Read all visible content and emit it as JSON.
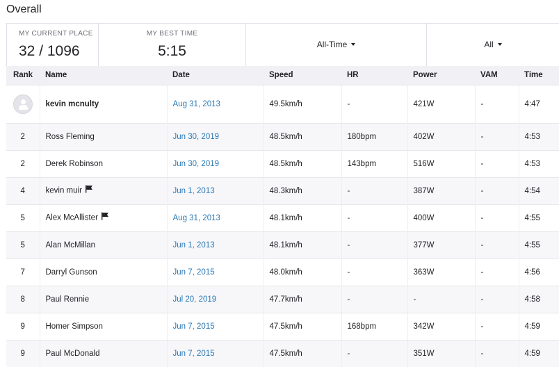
{
  "section": {
    "title": "Overall"
  },
  "stats": {
    "current_place_label": "MY CURRENT PLACE",
    "current_place_value": "32 / 1096",
    "best_time_label": "MY BEST TIME",
    "best_time_value": "5:15",
    "period_select": "All-Time",
    "filter_select": "All"
  },
  "table": {
    "headers": [
      "Rank",
      "Name",
      "Date",
      "Speed",
      "HR",
      "Power",
      "VAM",
      "Time"
    ],
    "rows": [
      {
        "rank": "",
        "name": "kevin mcnulty",
        "date": "Aug 31, 2013",
        "speed": "49.5km/h",
        "hr": "-",
        "power": "421W",
        "vam": "-",
        "time": "4:47",
        "avatar_icon": "user-avatar-icon",
        "flag_icon": ""
      },
      {
        "rank": "2",
        "name": "Ross Fleming",
        "date": "Jun 30, 2019",
        "speed": "48.5km/h",
        "hr": "180bpm",
        "power": "402W",
        "vam": "-",
        "time": "4:53",
        "flag_icon": ""
      },
      {
        "rank": "2",
        "name": "Derek Robinson",
        "date": "Jun 30, 2019",
        "speed": "48.5km/h",
        "hr": "143bpm",
        "power": "516W",
        "vam": "-",
        "time": "4:53",
        "flag_icon": ""
      },
      {
        "rank": "4",
        "name": "kevin muir",
        "date": "Jun 1, 2013",
        "speed": "48.3km/h",
        "hr": "-",
        "power": "387W",
        "vam": "-",
        "time": "4:54",
        "flag_icon": "flag-icon"
      },
      {
        "rank": "5",
        "name": "Alex McAllister",
        "date": "Aug 31, 2013",
        "speed": "48.1km/h",
        "hr": "-",
        "power": "400W",
        "vam": "-",
        "time": "4:55",
        "flag_icon": "flag-icon"
      },
      {
        "rank": "5",
        "name": "Alan McMillan",
        "date": "Jun 1, 2013",
        "speed": "48.1km/h",
        "hr": "-",
        "power": "377W",
        "vam": "-",
        "time": "4:55",
        "flag_icon": ""
      },
      {
        "rank": "7",
        "name": "Darryl Gunson",
        "date": "Jun 7, 2015",
        "speed": "48.0km/h",
        "hr": "-",
        "power": "363W",
        "vam": "-",
        "time": "4:56",
        "flag_icon": ""
      },
      {
        "rank": "8",
        "name": "Paul Rennie",
        "date": "Jul 20, 2019",
        "speed": "47.7km/h",
        "hr": "-",
        "power": "-",
        "vam": "-",
        "time": "4:58",
        "flag_icon": ""
      },
      {
        "rank": "9",
        "name": "Homer Simpson",
        "date": "Jun 7, 2015",
        "speed": "47.5km/h",
        "hr": "168bpm",
        "power": "342W",
        "vam": "-",
        "time": "4:59",
        "flag_icon": ""
      },
      {
        "rank": "9",
        "name": "Paul McDonald",
        "date": "Jun 7, 2015",
        "speed": "47.5km/h",
        "hr": "-",
        "power": "351W",
        "vam": "-",
        "time": "4:59",
        "flag_icon": ""
      }
    ]
  },
  "colors": {
    "link": "#2a78b4",
    "header_bg": "#f0f0f5",
    "row_alt_bg": "#f7f7fa"
  }
}
